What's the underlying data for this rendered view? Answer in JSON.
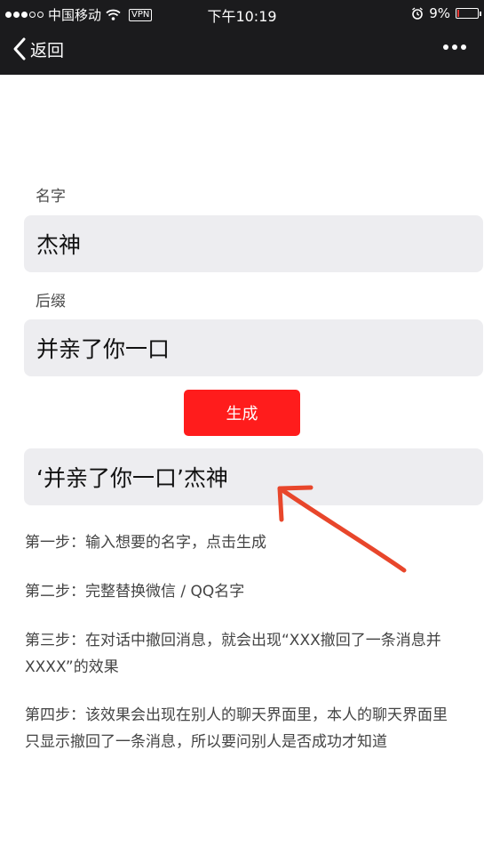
{
  "status_bar": {
    "carrier": "中国移动",
    "vpn": "VPN",
    "time": "下午10:19",
    "battery": "9%",
    "battery_level": 0.09,
    "colors": {
      "battery_low": "#e53935"
    }
  },
  "nav": {
    "back_label": "返回",
    "icons": {
      "back": "chevron-left-icon",
      "more": "more-dots-icon"
    }
  },
  "form": {
    "name_label": "名字",
    "name_value": "杰神",
    "suffix_label": "后缀",
    "suffix_value": "并亲了你一口",
    "generate_label": "生成",
    "result": "ʻ并亲了你一口ʼ杰神",
    "colors": {
      "generate_button": "#ff1c1c",
      "field_bg": "#ededf0"
    }
  },
  "steps": [
    "第一步：输入想要的名字，点击生成",
    "第二步：完整替换微信 / QQ名字",
    "第三步：在对话中撤回消息，就会出现“XXX撤回了一条消息并XXXX”的效果",
    "第四步：该效果会出现在别人的聊天界面里，本人的聊天界面里只显示撤回了一条消息，所以要问别人是否成功才知道"
  ]
}
